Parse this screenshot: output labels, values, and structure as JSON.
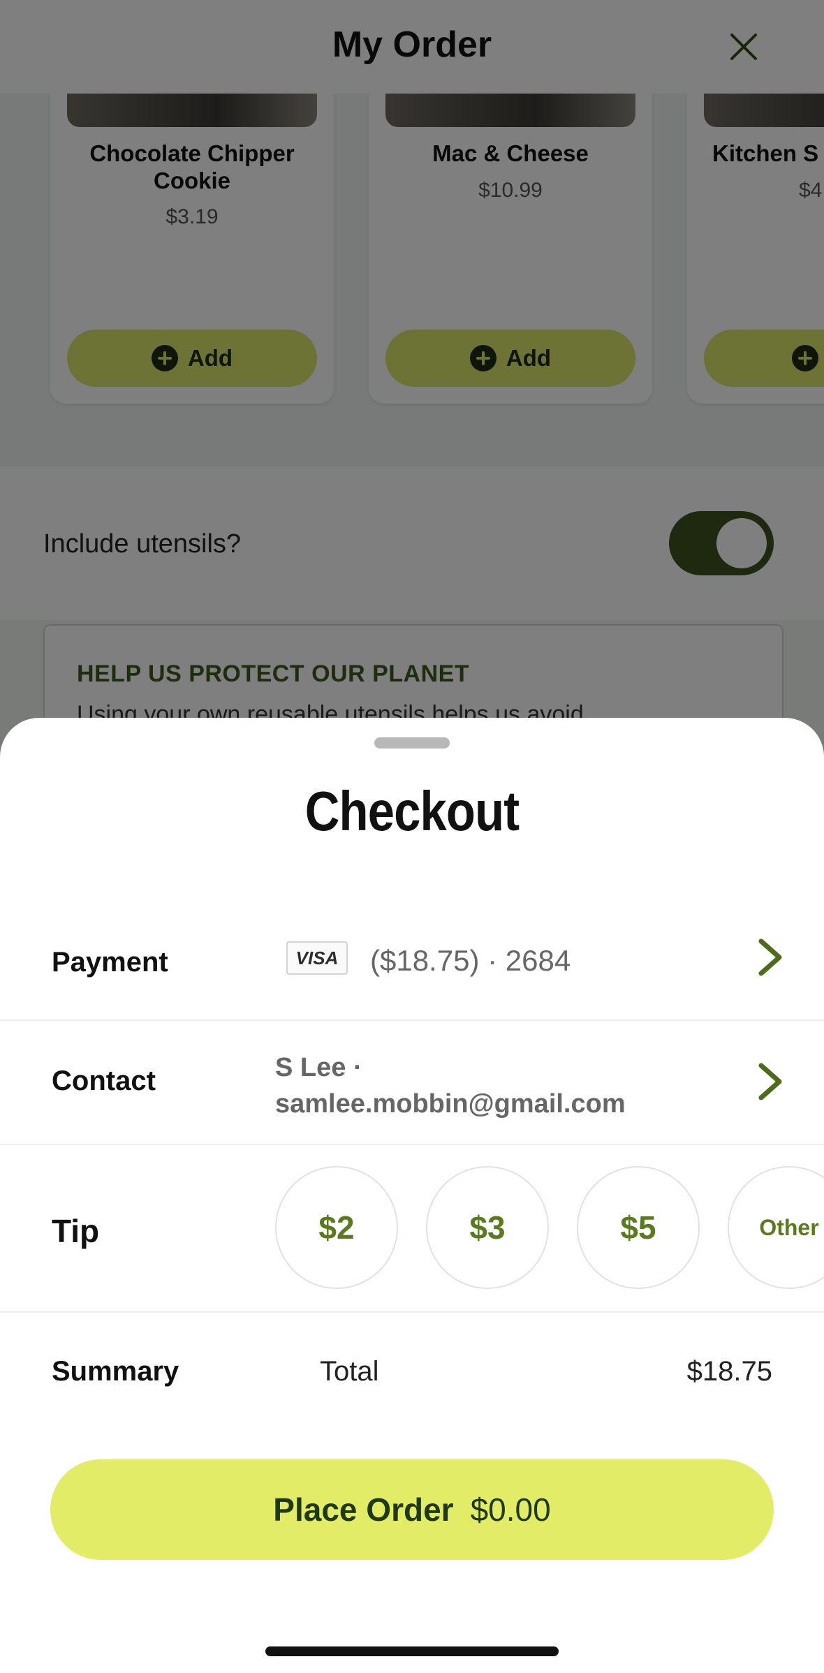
{
  "order_page": {
    "title": "My Order",
    "close_icon": "close-icon",
    "upsell_items": [
      {
        "name": "Chocolate Chipper Cookie",
        "price": "$3.19",
        "add_label": "Add"
      },
      {
        "name": "Mac & Cheese",
        "price": "$10.99",
        "add_label": "Add"
      },
      {
        "name": "Kitchen S",
        "price": "$4",
        "add_label": ""
      }
    ],
    "utensils": {
      "label": "Include utensils?",
      "enabled": true
    },
    "planet_notice": {
      "title": "HELP US PROTECT OUR PLANET",
      "text": "Using your own reusable utensils helps us avoid"
    }
  },
  "checkout": {
    "title": "Checkout",
    "payment": {
      "label": "Payment",
      "card_brand": "VISA",
      "value": "($18.75) · 2684"
    },
    "contact": {
      "label": "Contact",
      "name": "S Lee ·",
      "email": "samlee.mobbin@gmail.com"
    },
    "tip": {
      "label": "Tip",
      "options": [
        "$2",
        "$3",
        "$5",
        "Other"
      ]
    },
    "summary": {
      "label": "Summary",
      "total_label": "Total",
      "total_value": "$18.75"
    },
    "place_order": {
      "label": "Place Order",
      "amount": "$0.00"
    }
  },
  "colors": {
    "accent": "#e2ec66",
    "accent_dark": "#3c5320",
    "tip_text": "#5a7a1e"
  }
}
